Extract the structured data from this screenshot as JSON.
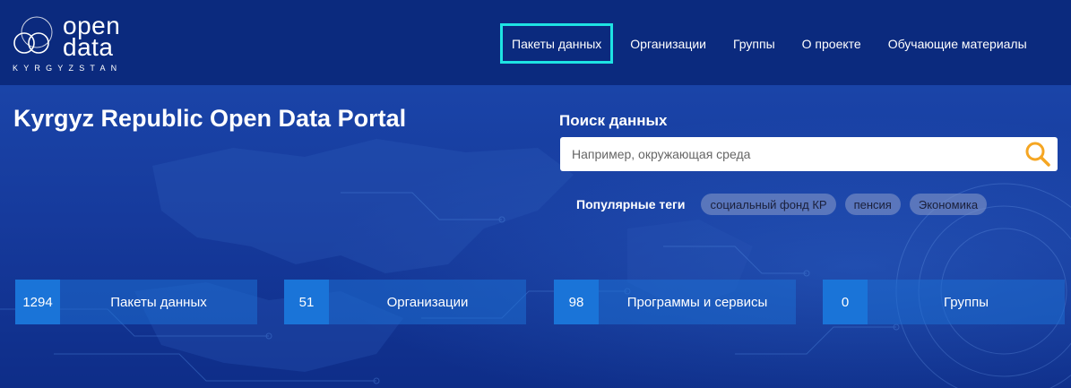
{
  "logo": {
    "line1": "open",
    "line2": "data",
    "country": "KYRGYZSTAN"
  },
  "nav": {
    "items": [
      {
        "label": "Пакеты данных"
      },
      {
        "label": "Организации"
      },
      {
        "label": "Группы"
      },
      {
        "label": "О проекте"
      },
      {
        "label": "Обучающие материалы"
      }
    ]
  },
  "hero": {
    "title": "Kyrgyz Republic Open Data Portal"
  },
  "search": {
    "label": "Поиск данных",
    "placeholder": "Например, окружающая среда",
    "icon": "search-icon"
  },
  "tags": {
    "label": "Популярные теги",
    "items": [
      "социальный фонд КР",
      "пенсия",
      "Экономика"
    ]
  },
  "stats": [
    {
      "count": "1294",
      "label": "Пакеты данных"
    },
    {
      "count": "51",
      "label": "Организации"
    },
    {
      "count": "98",
      "label": "Программы и сервисы"
    },
    {
      "count": "0",
      "label": "Группы"
    }
  ],
  "colors": {
    "header_bg": "#0b2a7e",
    "active_border": "#1ee3e3",
    "search_icon": "#f5a623",
    "stat_number_bg": "#1a74d8"
  }
}
